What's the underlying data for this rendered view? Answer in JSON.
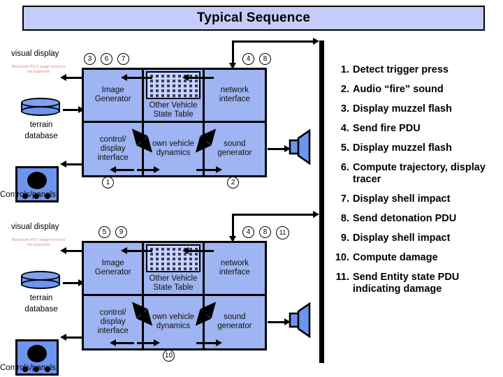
{
  "title": "Typical Sequence",
  "diagrams": [
    {
      "id": "top",
      "top_label": "visual display",
      "broken_image_text": "Macintosh PICT image format is not supported",
      "terrain_label_line1": "terrain",
      "terrain_label_line2": "database",
      "controls_label": "Controls/panels",
      "cells": [
        {
          "line1": "Image",
          "line2": "Generator"
        },
        {
          "line1": "Other Vehicle",
          "line2": "State Table"
        },
        {
          "line1": "network",
          "line2": "interface"
        },
        {
          "line1": "control/",
          "line2": "display",
          "line3": "interface"
        },
        {
          "line1": "own vehicle",
          "line2": "dynamics"
        },
        {
          "line1": "sound",
          "line2": "generator"
        }
      ],
      "markers_top_left": [
        "3",
        "6",
        "7"
      ],
      "markers_top_right": [
        "4",
        "8"
      ],
      "markers_bottom": [
        "1",
        "2"
      ]
    },
    {
      "id": "bottom",
      "top_label": "visual display",
      "broken_image_text": "Macintosh PICT image format is not supported",
      "terrain_label_line1": "terrain",
      "terrain_label_line2": "database",
      "controls_label": "Controls/panels",
      "cells": [
        {
          "line1": "Image",
          "line2": "Generator"
        },
        {
          "line1": "Other Vehicle",
          "line2": "State Table"
        },
        {
          "line1": "network",
          "line2": "interface"
        },
        {
          "line1": "control/",
          "line2": "display",
          "line3": "interface"
        },
        {
          "line1": "own vehicle",
          "line2": "dynamics"
        },
        {
          "line1": "sound",
          "line2": "generator"
        }
      ],
      "markers_top_left": [
        "5",
        "9"
      ],
      "markers_top_right": [
        "4",
        "8",
        "11"
      ],
      "markers_bottom": [
        "10"
      ]
    }
  ],
  "steps": [
    {
      "num": "1.",
      "text": "Detect trigger press"
    },
    {
      "num": "2.",
      "text": "Audio “fire” sound"
    },
    {
      "num": "3.",
      "text": "Display muzzel flash"
    },
    {
      "num": "4.",
      "text": "Send fire PDU"
    },
    {
      "num": "5.",
      "text": "Display muzzel flash"
    },
    {
      "num": "6.",
      "text": "Compute trajectory, display tracer"
    },
    {
      "num": "7.",
      "text": "Display shell impact"
    },
    {
      "num": "8.",
      "text": "Send detonation PDU"
    },
    {
      "num": "9.",
      "text": "Display shell impact"
    },
    {
      "num": "10.",
      "text": "Compute damage"
    },
    {
      "num": "11.",
      "text": "Send Entity state PDU indicating damage"
    }
  ],
  "colors": {
    "title_fill": "#c3cdf7",
    "box_fill": "#9fb4f2",
    "icon_fill": "#6d94ef",
    "line": "#000000",
    "broken_text": "#e08a8a"
  }
}
